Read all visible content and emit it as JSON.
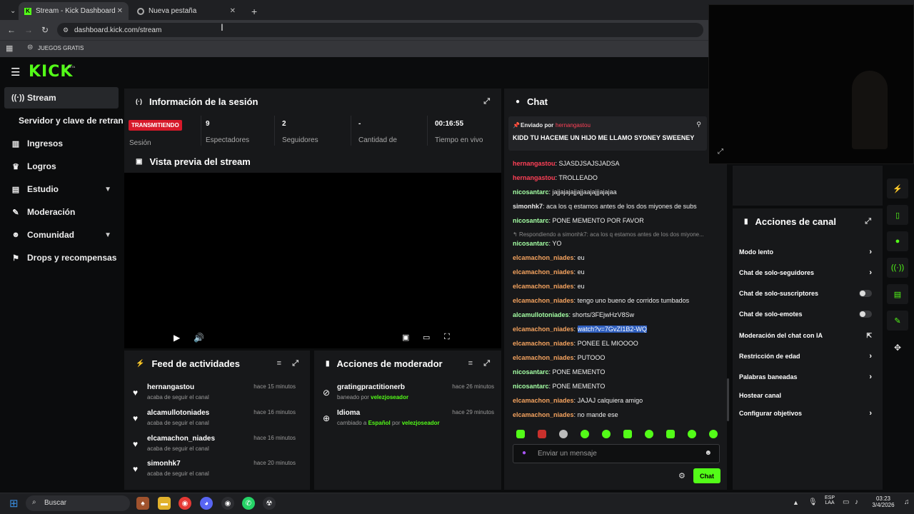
{
  "browser": {
    "tabs": [
      {
        "title": "Stream - Kick Dashboard"
      },
      {
        "title": "Nueva pestaña"
      }
    ],
    "url": "dashboard.kick.com/stream",
    "bookmark": "JUEGOS GRATIS"
  },
  "brand": {
    "logo": "KICK",
    "beta": "BETA",
    "accent": "#53fc18"
  },
  "sidebar": {
    "items": [
      {
        "label": "Stream",
        "icon": "broadcast-icon"
      },
      {
        "label": "Servidor y clave de retransm",
        "icon": ""
      },
      {
        "label": "Ingresos",
        "icon": "chart-icon"
      },
      {
        "label": "Logros",
        "icon": "trophy-icon"
      },
      {
        "label": "Estudio",
        "icon": "grid-icon"
      },
      {
        "label": "Moderación",
        "icon": "wrench-icon"
      },
      {
        "label": "Comunidad",
        "icon": "people-icon"
      },
      {
        "label": "Drops y recompensas",
        "icon": "gift-icon"
      }
    ]
  },
  "session": {
    "title": "Información de la sesión",
    "badge": "TRANSMITIENDO",
    "badge_label": "Sesión",
    "stats": [
      {
        "value": "9",
        "label": "Espectadores"
      },
      {
        "value": "2",
        "label": "Seguidores"
      },
      {
        "value": "-",
        "label": "Cantidad de"
      },
      {
        "value": "00:16:55",
        "label": "Tiempo en vivo"
      }
    ]
  },
  "preview": {
    "title": "Vista previa del stream"
  },
  "feed": {
    "title": "Feed de actividades",
    "items": [
      {
        "name": "hernangastou",
        "sub": "acaba de seguir el canal",
        "time": "hace 15 minutos"
      },
      {
        "name": "alcamullotoniades",
        "sub": "acaba de seguir el canal",
        "time": "hace 16 minutos"
      },
      {
        "name": "elcamachon_niades",
        "sub": "acaba de seguir el canal",
        "time": "hace 16 minutos"
      },
      {
        "name": "simonhk7",
        "sub": "acaba de seguir el canal",
        "time": "hace 20 minutos"
      }
    ]
  },
  "mod": {
    "title": "Acciones de moderador",
    "items": [
      {
        "name": "gratingpractitionerb",
        "sub1": "baneado por ",
        "by": "velezjoseador",
        "time": "hace 26 minutos"
      },
      {
        "name": "Idioma",
        "sub1": "cambiado a ",
        "lang": "Español",
        "sub2": " por ",
        "by": "velezjoseador",
        "time": "hace 29 minutos"
      }
    ]
  },
  "chat": {
    "title": "Chat",
    "pinned_by_label": "Enviado por",
    "pinned_by": "hernangastou",
    "pinned_text": "KIDD TU HACEME UN HIJO ME LLAMO SYDNEY SWEENEY",
    "messages": [
      {
        "user": "hernangastou",
        "text": "SJASDJSAJSJADSA",
        "color": "red"
      },
      {
        "user": "hernangastou",
        "text": "TROLLEADO",
        "color": "red"
      },
      {
        "user": "nicosantarc",
        "text": "jajjajajajjajjaajajjjajajaa",
        "color": "green"
      },
      {
        "user": "simonhk7",
        "text": "aca los q estamos antes de los dos miyones de subs",
        "color": "grey"
      },
      {
        "user": "nicosantarc",
        "text": "PONE MEMENTO POR FAVOR",
        "color": "green"
      },
      {
        "reply": "Respondiendo a simonhk7: aca los q estamos antes de los dos miyone..."
      },
      {
        "user": "nicosantarc",
        "text": "YO",
        "color": "green"
      },
      {
        "user": "elcamachon_niades",
        "text": "eu",
        "color": "orange"
      },
      {
        "user": "elcamachon_niades",
        "text": "eu",
        "color": "orange"
      },
      {
        "user": "elcamachon_niades",
        "text": "eu",
        "color": "orange"
      },
      {
        "user": "elcamachon_niades",
        "text": "tengo uno bueno de corridos tumbados",
        "color": "orange"
      },
      {
        "user": "alcamullotoniades",
        "text": "shorts/3FEjwHzV8Sw",
        "color": "green"
      },
      {
        "user": "elcamachon_niades",
        "text": "watch?v=7GvZI1B2-WQ",
        "color": "orange",
        "selected": true
      },
      {
        "user": "elcamachon_niades",
        "text": "PONEE EL MIOOOO",
        "color": "orange"
      },
      {
        "user": "elcamachon_niades",
        "text": "PUTOOO",
        "color": "orange"
      },
      {
        "user": "nicosantarc",
        "text": "PONE MEMENTO",
        "color": "green"
      },
      {
        "user": "nicosantarc",
        "text": "PONE MEMENTO",
        "color": "green"
      },
      {
        "user": "elcamachon_niades",
        "text": "JAJAJ calquiera amigo",
        "color": "orange"
      },
      {
        "user": "elcamachon_niades",
        "text": "no mande ese",
        "color": "orange"
      }
    ],
    "placeholder": "Enviar un mensaje",
    "send": "Chat"
  },
  "actions": {
    "title": "Acciones de canal",
    "items": [
      {
        "label": "Modo lento",
        "control": "chevron"
      },
      {
        "label": "Chat de solo-seguidores",
        "control": "chevron"
      },
      {
        "label": "Chat de solo-suscriptores",
        "control": "toggle"
      },
      {
        "label": "Chat de solo-emotes",
        "control": "toggle"
      },
      {
        "label": "Moderación del chat con IA",
        "control": "external"
      },
      {
        "label": "Restricción de edad",
        "control": "chevron"
      },
      {
        "label": "Palabras baneadas",
        "control": "chevron"
      },
      {
        "label": "Hostear canal",
        "control": "none"
      },
      {
        "label": "Configurar objetivos",
        "control": "chevron"
      }
    ]
  },
  "taskbar": {
    "search": "Buscar",
    "lang": "ESP",
    "lang2": "LAA",
    "time": "03:23",
    "date": "3/4/2026"
  }
}
